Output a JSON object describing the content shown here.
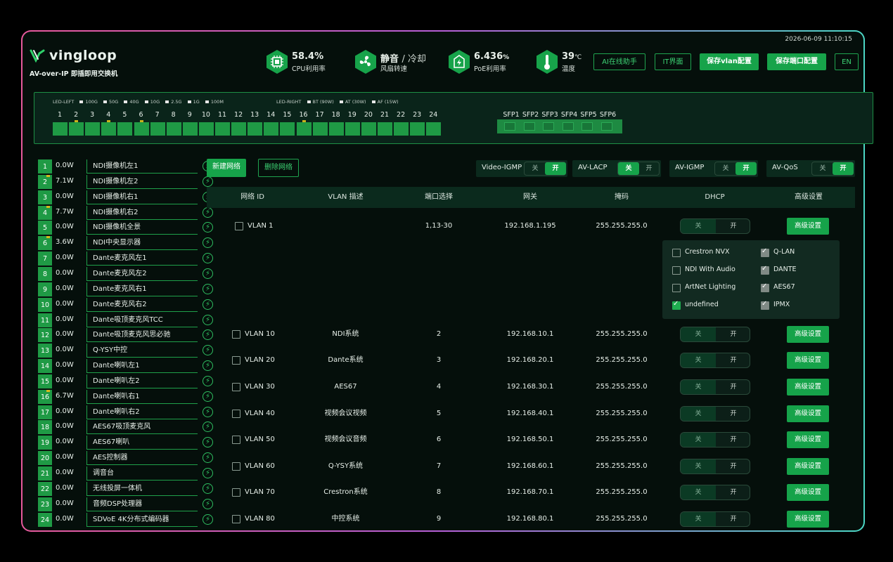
{
  "datetime": "2026-06-09 11:10:15",
  "brand": {
    "name": "vingloop",
    "subtitle": "AV-over-IP 即插即用交换机"
  },
  "stats": [
    {
      "icon": "cpu-icon",
      "value": "58.4%",
      "label": "CPU利用率"
    },
    {
      "icon": "fan-icon",
      "value": "静音",
      "value2": "/ 冷却",
      "label": "风扇转速"
    },
    {
      "icon": "poe-icon",
      "value": "6.436",
      "unit": "%",
      "label": "PoE利用率"
    },
    {
      "icon": "thermometer-icon",
      "value": "39",
      "unit": "℃",
      "label": "温度"
    }
  ],
  "header_buttons": {
    "ai": "AI在线助手",
    "it": "IT界面",
    "save_vlan": "保存vlan配置",
    "save_port": "保存端口配置",
    "lang": "EN"
  },
  "legend": {
    "left_title": "LED-LEFT",
    "left": [
      "100G",
      "50G",
      "40G",
      "10G",
      "2.5G",
      "1G",
      "100M"
    ],
    "right_title": "LED-RIGHT",
    "right": [
      "BT (90W)",
      "AT (30W)",
      "AF (15W)"
    ]
  },
  "ports": [
    "1",
    "2",
    "3",
    "4",
    "5",
    "6",
    "7",
    "8",
    "9",
    "10",
    "11",
    "12",
    "13",
    "14",
    "15",
    "16",
    "17",
    "18",
    "19",
    "20",
    "21",
    "22",
    "23",
    "24"
  ],
  "sfp": [
    "SFP1",
    "SFP2",
    "SFP3",
    "SFP4",
    "SFP5",
    "SFP6"
  ],
  "devices": [
    {
      "num": "1",
      "power": "0.0W",
      "name": "NDI摄像机左1"
    },
    {
      "num": "2",
      "power": "7.1W",
      "name": "NDI摄像机左2"
    },
    {
      "num": "3",
      "power": "0.0W",
      "name": "NDI摄像机右1"
    },
    {
      "num": "4",
      "power": "7.7W",
      "name": "NDI摄像机右2"
    },
    {
      "num": "5",
      "power": "0.0W",
      "name": "NDI摄像机全景"
    },
    {
      "num": "6",
      "power": "3.6W",
      "name": "NDI中央显示器"
    },
    {
      "num": "7",
      "power": "0.0W",
      "name": "Dante麦克风左1"
    },
    {
      "num": "8",
      "power": "0.0W",
      "name": "Dante麦克风左2"
    },
    {
      "num": "9",
      "power": "0.0W",
      "name": "Dante麦克风右1"
    },
    {
      "num": "10",
      "power": "0.0W",
      "name": "Dante麦克风右2"
    },
    {
      "num": "11",
      "power": "0.0W",
      "name": "Dante吸顶麦克风TCC"
    },
    {
      "num": "12",
      "power": "0.0W",
      "name": "Dante吸顶麦克风思必驰"
    },
    {
      "num": "13",
      "power": "0.0W",
      "name": "Q-YSY中控"
    },
    {
      "num": "14",
      "power": "0.0W",
      "name": "Dante喇叭左1"
    },
    {
      "num": "15",
      "power": "0.0W",
      "name": "Dante喇叭左2"
    },
    {
      "num": "16",
      "power": "6.7W",
      "name": "Dante喇叭右1"
    },
    {
      "num": "17",
      "power": "0.0W",
      "name": "Dante喇叭右2"
    },
    {
      "num": "18",
      "power": "0.0W",
      "name": "AES67吸顶麦克风"
    },
    {
      "num": "19",
      "power": "0.0W",
      "name": "AES67喇叭"
    },
    {
      "num": "20",
      "power": "0.0W",
      "name": "AES控制器"
    },
    {
      "num": "21",
      "power": "0.0W",
      "name": "调音台"
    },
    {
      "num": "22",
      "power": "0.0W",
      "name": "无线投屏一体机"
    },
    {
      "num": "23",
      "power": "0.0W",
      "name": "音频DSP处理器"
    },
    {
      "num": "24",
      "power": "0.0W",
      "name": "SDVoE 4K分布式编码器"
    }
  ],
  "toolbar": {
    "new_network": "新建网络",
    "delete_network": "删除网络"
  },
  "toggles": [
    {
      "label": "Video-IGMP",
      "off": "关",
      "on": "开",
      "state": "on"
    },
    {
      "label": "AV-LACP",
      "off": "关",
      "on": "开",
      "state": "off"
    },
    {
      "label": "AV-IGMP",
      "off": "关",
      "on": "开",
      "state": "on"
    },
    {
      "label": "AV-QoS",
      "off": "关",
      "on": "开",
      "state": "on"
    }
  ],
  "table": {
    "headers": [
      "网络 ID",
      "VLAN 描述",
      "端口选择",
      "网关",
      "掩码",
      "DHCP",
      "高级设置"
    ],
    "dhcp_off": "关",
    "dhcp_on": "开",
    "advanced_label": "高级设置",
    "rows": [
      {
        "id": "VLAN 1",
        "desc": "",
        "ports": "1,13-30",
        "gateway": "192.168.1.195",
        "mask": "255.255.255.0"
      },
      {
        "id": "VLAN 10",
        "desc": "NDI系统",
        "ports": "2",
        "gateway": "192.168.10.1",
        "mask": "255.255.255.0"
      },
      {
        "id": "VLAN 20",
        "desc": "Dante系统",
        "ports": "3",
        "gateway": "192.168.20.1",
        "mask": "255.255.255.0"
      },
      {
        "id": "VLAN 30",
        "desc": "AES67",
        "ports": "4",
        "gateway": "192.168.30.1",
        "mask": "255.255.255.0"
      },
      {
        "id": "VLAN 40",
        "desc": "视频会议视频",
        "ports": "5",
        "gateway": "192.168.40.1",
        "mask": "255.255.255.0"
      },
      {
        "id": "VLAN 50",
        "desc": "视频会议音频",
        "ports": "6",
        "gateway": "192.168.50.1",
        "mask": "255.255.255.0"
      },
      {
        "id": "VLAN 60",
        "desc": "Q-YSY系统",
        "ports": "7",
        "gateway": "192.168.60.1",
        "mask": "255.255.255.0"
      },
      {
        "id": "VLAN 70",
        "desc": "Crestron系统",
        "ports": "8",
        "gateway": "192.168.70.1",
        "mask": "255.255.255.0"
      },
      {
        "id": "VLAN 80",
        "desc": "中控系统",
        "ports": "9",
        "gateway": "192.168.80.1",
        "mask": "255.255.255.0"
      }
    ]
  },
  "popup": {
    "items": [
      {
        "label": "Crestron NVX",
        "checked": false
      },
      {
        "label": "Q-LAN",
        "checked": true
      },
      {
        "label": "NDI With Audio",
        "checked": false
      },
      {
        "label": "DANTE",
        "checked": true
      },
      {
        "label": "ArtNet Lighting",
        "checked": false
      },
      {
        "label": "AES67",
        "checked": true
      },
      {
        "label": "undefined",
        "checked": true
      },
      {
        "label": "IPMX",
        "checked": true
      }
    ]
  },
  "colors": {
    "accent": "#16a34a",
    "port": "#1f9a45",
    "indicator": "#d6ba1c",
    "frame_gradient": [
      "#e75a9c",
      "#4bd6c4"
    ]
  }
}
